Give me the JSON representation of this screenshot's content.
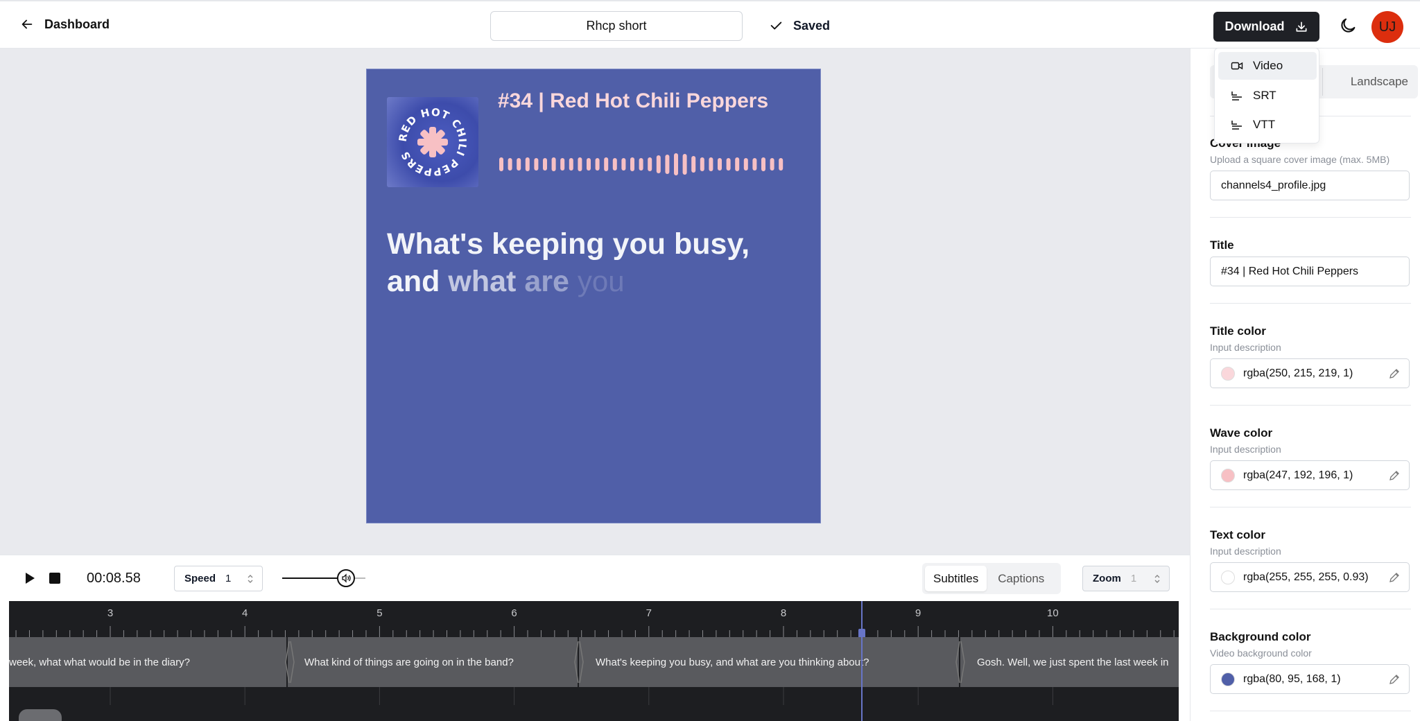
{
  "header": {
    "back_label": "Dashboard",
    "project_name": "Rhcp short",
    "save_status": "Saved",
    "download_label": "Download",
    "avatar_initials": "UJ"
  },
  "download_menu": {
    "items": [
      {
        "label": "Video",
        "icon": "video-icon"
      },
      {
        "label": "SRT",
        "icon": "subtitle-file-icon"
      },
      {
        "label": "VTT",
        "icon": "subtitle-file-icon"
      }
    ]
  },
  "preview": {
    "title": "#34 | Red Hot Chili Peppers",
    "cover_text": "RED HOT CHILI PEPPERS",
    "subtitle_line1": "What's keeping you busy,",
    "subtitle_words": [
      "and",
      "what",
      "are",
      "you"
    ],
    "background_color": "#505fa8",
    "title_color": "#fad7db",
    "wave_color": "#f7c0c4"
  },
  "controls": {
    "time": "00:08.58",
    "speed_label": "Speed",
    "speed_value": "1",
    "volume_level": 0.75,
    "mode_tabs": [
      "Subtitles",
      "Captions"
    ],
    "active_mode": "Subtitles",
    "zoom_label": "Zoom",
    "zoom_value": "1"
  },
  "timeline": {
    "ruler_labels": [
      "3",
      "4",
      "5",
      "6",
      "7",
      "8",
      "9",
      "10"
    ],
    "clips": [
      "week, what what would be in the diary?",
      "What kind of things are going on in the band?",
      "What's keeping you busy, and what are you thinking about?",
      "Gosh. Well, we just spent the last week in"
    ]
  },
  "panel": {
    "orientation_option": "Landscape",
    "cover_image": {
      "label": "Cover image",
      "description": "Upload a square cover image (max. 5MB)",
      "value": "channels4_profile.jpg"
    },
    "title": {
      "label": "Title",
      "value": "#34 | Red Hot Chili Peppers"
    },
    "title_color": {
      "label": "Title color",
      "description": "Input description",
      "value": "rgba(250, 215, 219, 1)",
      "swatch": "#fad7db"
    },
    "wave_color": {
      "label": "Wave color",
      "description": "Input description",
      "value": "rgba(247, 192, 196, 1)",
      "swatch": "#f7c0c4"
    },
    "text_color": {
      "label": "Text color",
      "description": "Input description",
      "value": "rgba(255, 255, 255, 0.93)",
      "swatch": "#ffffff"
    },
    "background_color": {
      "label": "Background color",
      "description": "Video background color",
      "value": "rgba(80, 95, 168, 1)",
      "swatch": "#505fa8"
    }
  }
}
